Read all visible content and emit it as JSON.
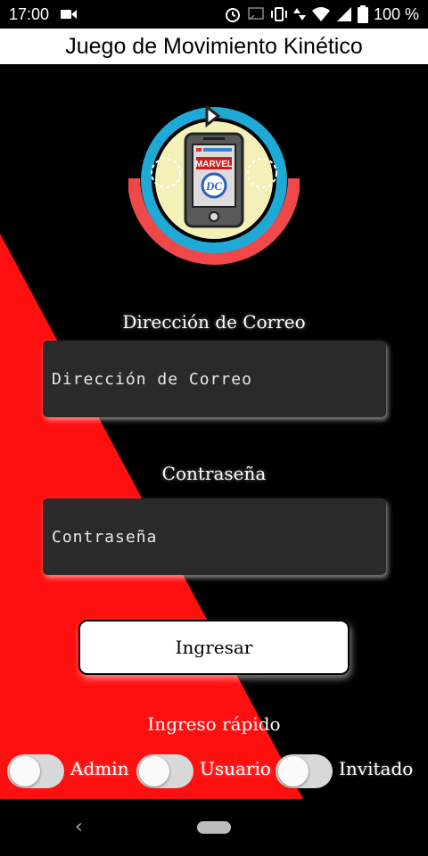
{
  "status_bar": {
    "time": "17:00",
    "battery_text": "100 %",
    "icons": [
      "video-icon",
      "alarm-icon",
      "cast-icon",
      "vibrate-icon",
      "wifi-icon",
      "signal-icon",
      "battery-icon"
    ]
  },
  "app": {
    "title": "Juego de Movimiento Kinético"
  },
  "logo": {
    "text_top": "MARVEL",
    "text_bottom": "DC"
  },
  "form": {
    "email_label": "Dirección de Correo",
    "email_placeholder": "Dirección de Correo",
    "email_value": "",
    "password_label": "Contraseña",
    "password_placeholder": "Contraseña",
    "password_value": "",
    "login_label": "Ingresar"
  },
  "quick_login": {
    "title": "Ingreso rápido",
    "options": [
      {
        "label": "Admin",
        "on": false
      },
      {
        "label": "Usuario",
        "on": false
      },
      {
        "label": "Invitado",
        "on": false
      }
    ]
  },
  "colors": {
    "accent_red": "#ff1010",
    "ring_blue": "#1fa9d6",
    "ring_red": "#f04848",
    "logo_bg": "#f3f0b8"
  }
}
